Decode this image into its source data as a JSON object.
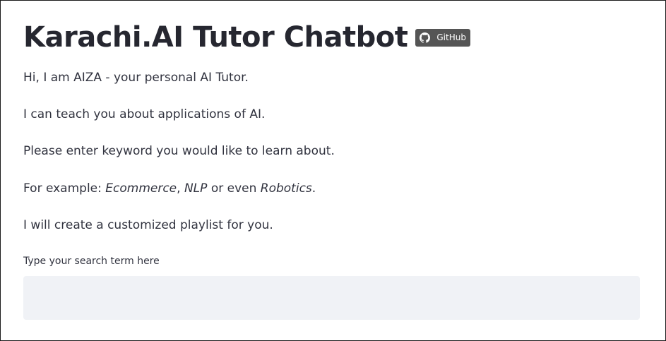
{
  "header": {
    "title": "Karachi.AI Tutor Chatbot",
    "badge": {
      "icon": "github-icon",
      "label": "GitHub",
      "color": "#555555"
    }
  },
  "intro": {
    "line1": "Hi, I am AIZA - your personal AI Tutor.",
    "line2": "I can teach you about applications of AI.",
    "line3": "Please enter keyword you would like to learn about.",
    "line4": {
      "prefix": "For example: ",
      "example1": "Ecommerce",
      "sep1": ", ",
      "example2": "NLP",
      "sep2": " or even ",
      "example3": "Robotics",
      "suffix": "."
    },
    "line5": "I will create a customized playlist for you."
  },
  "search": {
    "label": "Type your search term here",
    "value": "",
    "placeholder": ""
  },
  "colors": {
    "text": "#31333f",
    "input_bg": "#f0f2f6",
    "badge_bg": "#555555"
  }
}
